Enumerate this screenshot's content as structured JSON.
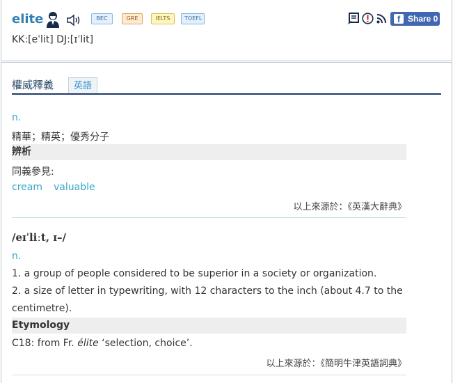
{
  "header": {
    "word": "elite",
    "pronunciation": "KK:[eˈlit] DJ:[ɪˈlit]",
    "tags": [
      "BEC",
      "GRE",
      "IELTS",
      "TOEFL"
    ],
    "share_label": "Share 0",
    "fb_glyph": "f"
  },
  "tabs": {
    "active": "權威釋義",
    "language": "英語"
  },
  "entry1": {
    "pos": "n.",
    "definition": "精華；精英；優秀分子",
    "analysis_heading": "辨析",
    "synonyms_label": "同義參見:",
    "synonyms": [
      "cream",
      "valuable"
    ],
    "source": "以上來源於：《英漢大辭典》"
  },
  "entry2": {
    "phonetic": "/eɪˈliːt, ɪ–/",
    "pos": "n.",
    "def1": "1. a group of people considered to be superior in a society or organization.",
    "def2_line1": "2. a size of letter in typewriting, with 12 characters to the inch (about 4.7 to the",
    "def2_line2": "centimetre).",
    "etymology_heading": "Etymology",
    "etymology_prefix": "C18: from Fr.",
    "etymology_word": "élite",
    "etymology_gloss": "‘selection, choice’.",
    "source": "以上來源於：《簡明牛津英語詞典》"
  },
  "colors": {
    "word": "#2f7fb3",
    "pos": "#35a7c9",
    "tab_rule": "#1f3b6b",
    "facebook": "#4267b2"
  },
  "icons": [
    "user-icon",
    "speaker-icon",
    "note-icon",
    "alert-icon",
    "rss-icon",
    "facebook-icon"
  ]
}
